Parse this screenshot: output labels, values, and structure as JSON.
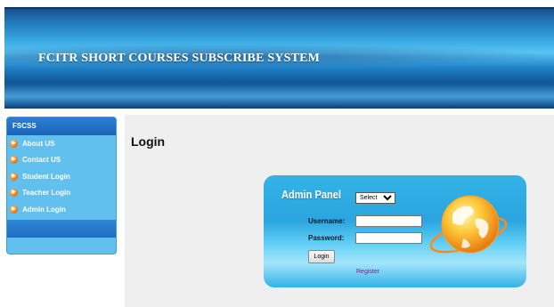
{
  "header": {
    "title": "FCITR SHORT COURSES SUBSCRIBE SYSTEM"
  },
  "sidebar": {
    "heading": "FSCSS",
    "items": [
      {
        "label": "About US"
      },
      {
        "label": "Contact US"
      },
      {
        "label": "Student Login"
      },
      {
        "label": "Teacher Login"
      },
      {
        "label": "Admin Login"
      }
    ]
  },
  "main": {
    "title": "Login",
    "panel": {
      "heading": "Admin Panel",
      "select_value": "Select",
      "username_label": "Username:",
      "username_value": "",
      "password_label": "Password:",
      "password_value": "",
      "login_button": "Login",
      "register_link": "Register"
    }
  },
  "colors": {
    "header_blue": "#1e76b8",
    "sidebar_blue": "#62c0ee",
    "panel_blue": "#2aa5df",
    "bullet_orange": "#f07b12",
    "register_purple": "#6b2a8a"
  },
  "icons": [
    "arrow-bullet-icon",
    "globe-icon"
  ]
}
